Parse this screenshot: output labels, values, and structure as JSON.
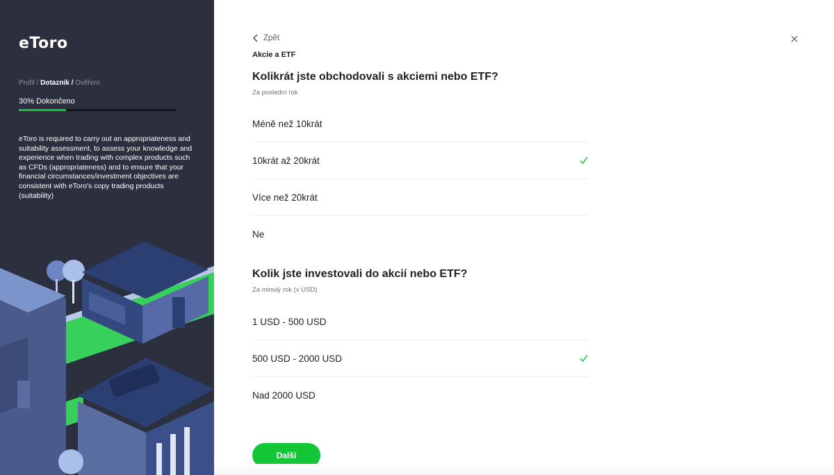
{
  "sidebar": {
    "logo": "eToro",
    "breadcrumb": {
      "step1": "Profil",
      "step2": "Dotazník",
      "step3": "Ověření",
      "separator": "/"
    },
    "progress": {
      "label": "30% Dokončeno",
      "value": 0.3
    },
    "description": "eToro is required to carry out an appropriateness and suitability assessment, to assess your knowledge and experience when trading with complex products such as CFDs (appropriateness) and to ensure that your financial circumstances/investment objectives are consistent with eToro's copy trading products (suitability)"
  },
  "header": {
    "back_label": "Zpět",
    "section_tag": "Akcie a ETF",
    "close_icon": "close-icon"
  },
  "questions": [
    {
      "title": "Kolikrát jste obchodovali s akciemi nebo ETF?",
      "subtitle": "Za poslední rok",
      "options": [
        {
          "label": "Méně než 10krát",
          "selected": false
        },
        {
          "label": "10krát až 20krát",
          "selected": true
        },
        {
          "label": "Více než 20krát",
          "selected": false
        },
        {
          "label": "Ne",
          "selected": false
        }
      ]
    },
    {
      "title": "Kolik jste investovali do akcií nebo ETF?",
      "subtitle": "Za minulý rok (v USD)",
      "options": [
        {
          "label": "1 USD - 500 USD",
          "selected": false
        },
        {
          "label": "500 USD - 2000 USD",
          "selected": true
        },
        {
          "label": "Nad 2000 USD",
          "selected": false
        }
      ]
    }
  ],
  "next_button": "Další",
  "colors": {
    "accent": "#13c636",
    "sidebar_bg": "#2c2f3e",
    "text": "#1f1f1f",
    "muted": "#6a6f82"
  }
}
